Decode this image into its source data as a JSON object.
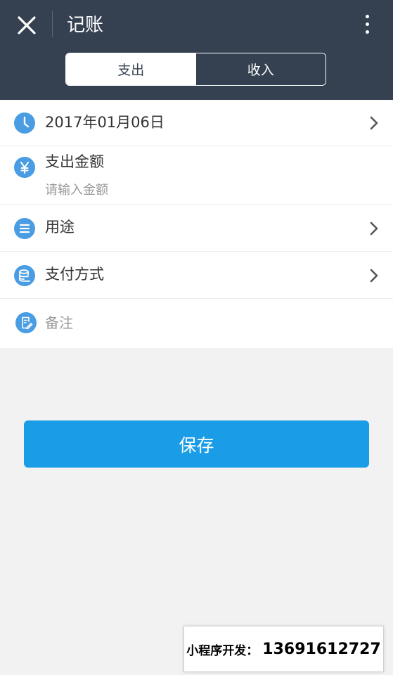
{
  "header": {
    "title": "记账",
    "tabs": [
      "支出",
      "收入"
    ],
    "active_tab": 0,
    "background_color": "#354050"
  },
  "form": {
    "date": {
      "value": "2017年01月06日",
      "icon": "clock-icon"
    },
    "amount": {
      "label": "支出金额",
      "placeholder": "请输入金额",
      "icon": "yen-icon"
    },
    "usage": {
      "label": "用途",
      "icon": "list-icon"
    },
    "payment": {
      "label": "支付方式",
      "icon": "database-icon"
    },
    "note": {
      "placeholder": "备注",
      "icon": "note-edit-icon"
    }
  },
  "actions": {
    "save_label": "保存",
    "save_color": "#1a9de6"
  },
  "watermark": {
    "label": "小程序开发：",
    "phone": "13691612727"
  },
  "icon_color": "#4a9de2"
}
